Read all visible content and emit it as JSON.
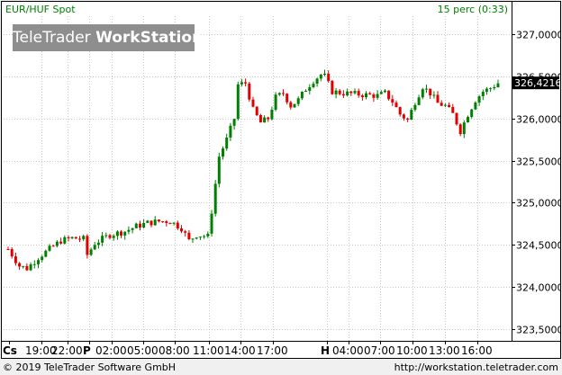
{
  "header": {
    "symbol": "EUR/HUF Spot",
    "interval": "15 perc (0:33)"
  },
  "watermark": {
    "part1": "TeleTrader ",
    "part2": "WorkStation"
  },
  "footer": {
    "copyright": "© 2019 TeleTrader Software GmbH",
    "url": "http://workstation.teletrader.com"
  },
  "colors": {
    "up": "#008000",
    "down": "#e00000",
    "grid": "#c8c8c8",
    "header_text": "#008000"
  },
  "chart_data": {
    "type": "candlestick",
    "series_name": "EUR/HUF Spot",
    "interval": "15 perc",
    "y_axis_side": "right",
    "ylim": [
      323.3,
      327.25
    ],
    "y_ticks": [
      323.5,
      324.0,
      324.5,
      325.0,
      325.5,
      326.0,
      326.5,
      327.0
    ],
    "y_tick_labels": [
      "323,5000",
      "324,0000",
      "324,5000",
      "325,0000",
      "325,5000",
      "326,0000",
      "326,5000",
      "327,0000"
    ],
    "x_tick_labels": [
      {
        "label": "Cs",
        "bold": true
      },
      {
        "label": "19:00",
        "bold": false
      },
      {
        "label": "22:00",
        "bold": false
      },
      {
        "label": "P",
        "bold": true
      },
      {
        "label": "02:00",
        "bold": false
      },
      {
        "label": "05:00",
        "bold": false
      },
      {
        "label": "08:00",
        "bold": false
      },
      {
        "label": "11:00",
        "bold": false
      },
      {
        "label": "14:00",
        "bold": false
      },
      {
        "label": "17:00",
        "bold": false
      },
      {
        "label": "H",
        "bold": true
      },
      {
        "label": "04:00",
        "bold": false
      },
      {
        "label": "07:00",
        "bold": false
      },
      {
        "label": "10:00",
        "bold": false
      },
      {
        "label": "13:00",
        "bold": false
      },
      {
        "label": "16:00",
        "bold": false
      }
    ],
    "last_price": 326.4216,
    "last_price_label": "326,4216",
    "grid": true,
    "close_path": [
      [
        0,
        324.45
      ],
      [
        3,
        324.25
      ],
      [
        5,
        324.22
      ],
      [
        8,
        324.35
      ],
      [
        11,
        324.45
      ],
      [
        14,
        324.55
      ],
      [
        17,
        324.58
      ],
      [
        20,
        324.57
      ],
      [
        21,
        324.38
      ],
      [
        23,
        324.52
      ],
      [
        27,
        324.62
      ],
      [
        31,
        324.66
      ],
      [
        34,
        324.72
      ],
      [
        37,
        324.76
      ],
      [
        40,
        324.78
      ],
      [
        43,
        324.78
      ],
      [
        46,
        324.7
      ],
      [
        48,
        324.55
      ],
      [
        50,
        324.62
      ],
      [
        53,
        324.6
      ],
      [
        54,
        324.9
      ],
      [
        56,
        325.55
      ],
      [
        58,
        325.75
      ],
      [
        60,
        326.0
      ],
      [
        61,
        326.4
      ],
      [
        63,
        326.42
      ],
      [
        65,
        326.1
      ],
      [
        67,
        325.95
      ],
      [
        69,
        326.0
      ],
      [
        71,
        326.25
      ],
      [
        73,
        326.3
      ],
      [
        75,
        326.15
      ],
      [
        77,
        326.22
      ],
      [
        79,
        326.35
      ],
      [
        81,
        326.45
      ],
      [
        83,
        326.52
      ],
      [
        84,
        326.5
      ],
      [
        86,
        326.32
      ],
      [
        89,
        326.3
      ],
      [
        92,
        326.29
      ],
      [
        95,
        326.28
      ],
      [
        98,
        326.27
      ],
      [
        100,
        326.3
      ],
      [
        102,
        326.2
      ],
      [
        104,
        326.05
      ],
      [
        106,
        325.98
      ],
      [
        108,
        326.2
      ],
      [
        110,
        326.38
      ],
      [
        112,
        326.3
      ],
      [
        114,
        326.18
      ],
      [
        116,
        326.15
      ],
      [
        118,
        326.05
      ],
      [
        120,
        325.85
      ],
      [
        122,
        326.05
      ],
      [
        124,
        326.22
      ],
      [
        126,
        326.32
      ],
      [
        128,
        326.36
      ],
      [
        130,
        326.42
      ]
    ]
  }
}
